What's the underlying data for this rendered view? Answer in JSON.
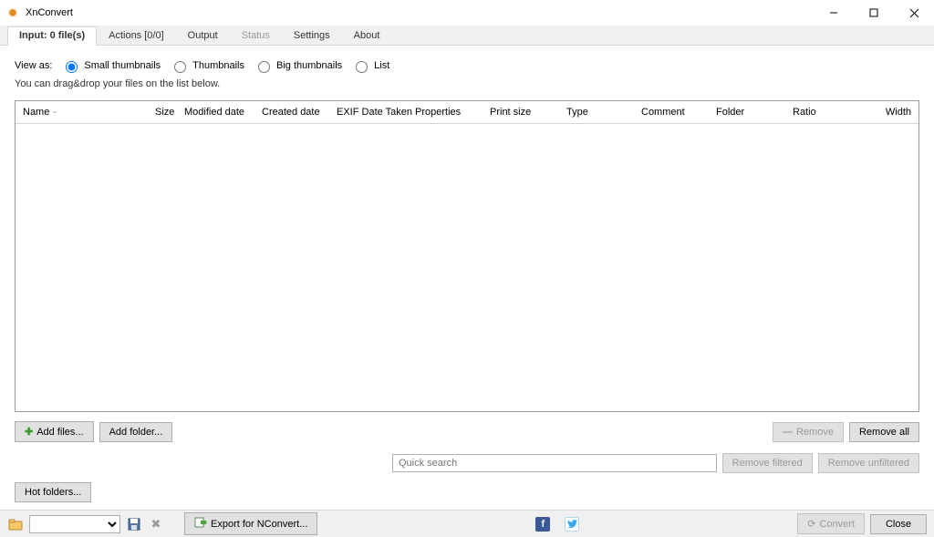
{
  "title": "XnConvert",
  "tabs": {
    "input": {
      "label": "Input: 0 file(s)",
      "active": true
    },
    "actions": {
      "label": "Actions [0/0]"
    },
    "output": {
      "label": "Output"
    },
    "status": {
      "label": "Status",
      "disabled": true
    },
    "settings": {
      "label": "Settings"
    },
    "about": {
      "label": "About"
    }
  },
  "viewas": {
    "label": "View as:",
    "options": {
      "small": "Small thumbnails",
      "thumb": "Thumbnails",
      "big": "Big thumbnails",
      "list": "List"
    },
    "selected": "small"
  },
  "hint": "You can drag&drop your files on the list below.",
  "columns": [
    "Name",
    "Size",
    "Modified date",
    "Created date",
    "EXIF Date Taken",
    "Properties",
    "Print size",
    "Type",
    "Comment",
    "Folder",
    "Ratio",
    "Width"
  ],
  "buttons": {
    "add_files": "Add files...",
    "add_folder": "Add folder...",
    "remove": "Remove",
    "remove_all": "Remove all",
    "remove_filtered": "Remove filtered",
    "remove_unfiltered": "Remove unfiltered",
    "hot_folders": "Hot folders...",
    "export_preset": "Export for NConvert...",
    "convert": "Convert",
    "close": "Close"
  },
  "quicksearch_placeholder": "Quick search"
}
